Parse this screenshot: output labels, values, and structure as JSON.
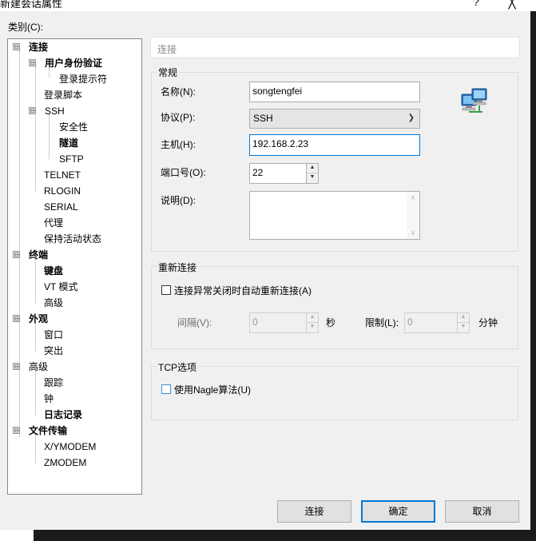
{
  "window": {
    "title": "新建会话属性",
    "help_glyph": "?",
    "close_glyph": "╳"
  },
  "category_label": "类别(C):",
  "tree": {
    "items": [
      {
        "label": "连接",
        "bold": true,
        "expander": "⊟"
      },
      {
        "label": "用户身份验证",
        "bold": true,
        "expander": "⊟"
      },
      {
        "label": "登录提示符"
      },
      {
        "label": "登录脚本"
      },
      {
        "label": "SSH",
        "expander": "⊟"
      },
      {
        "label": "安全性"
      },
      {
        "label": "隧道",
        "bold": true
      },
      {
        "label": "SFTP"
      },
      {
        "label": "TELNET"
      },
      {
        "label": "RLOGIN"
      },
      {
        "label": "SERIAL"
      },
      {
        "label": "代理"
      },
      {
        "label": "保持活动状态"
      },
      {
        "label": "终端",
        "bold": true,
        "expander": "⊟"
      },
      {
        "label": "键盘",
        "bold": true
      },
      {
        "label": "VT 模式"
      },
      {
        "label": "高级"
      },
      {
        "label": "外观",
        "bold": true,
        "expander": "⊟"
      },
      {
        "label": "窗口"
      },
      {
        "label": "突出"
      },
      {
        "label": "高级",
        "expander": "⊟"
      },
      {
        "label": "跟踪"
      },
      {
        "label": "钟"
      },
      {
        "label": "日志记录",
        "bold": true
      },
      {
        "label": "文件传输",
        "bold": true,
        "expander": "⊟"
      },
      {
        "label": "X/YMODEM"
      },
      {
        "label": "ZMODEM"
      }
    ]
  },
  "section_header": "连接",
  "general": {
    "title": "常规",
    "name_label": "名称(N):",
    "name_value": "songtengfei",
    "protocol_label": "协议(P):",
    "protocol_value": "SSH",
    "host_label": "主机(H):",
    "host_value": "192.168.2.23",
    "port_label": "端口号(O):",
    "port_value": "22",
    "desc_label": "说明(D):",
    "desc_value": "",
    "icon": "network-computers-icon"
  },
  "reconnect": {
    "title": "重新连接",
    "auto_label": "连接异常关闭时自动重新连接(A)",
    "auto_checked": false,
    "interval_label": "间隔(V):",
    "interval_value": "0",
    "seconds_unit": "秒",
    "limit_label": "限制(L):",
    "limit_value": "0",
    "minutes_unit": "分钟"
  },
  "tcp": {
    "title": "TCP选项",
    "nagle_label": "使用Nagle算法(U)",
    "nagle_checked": false
  },
  "buttons": {
    "connect": "连接",
    "ok": "确定",
    "cancel": "取消"
  },
  "colors": {
    "accent": "#0078d7",
    "dialog_bg": "#f0f0f0"
  }
}
